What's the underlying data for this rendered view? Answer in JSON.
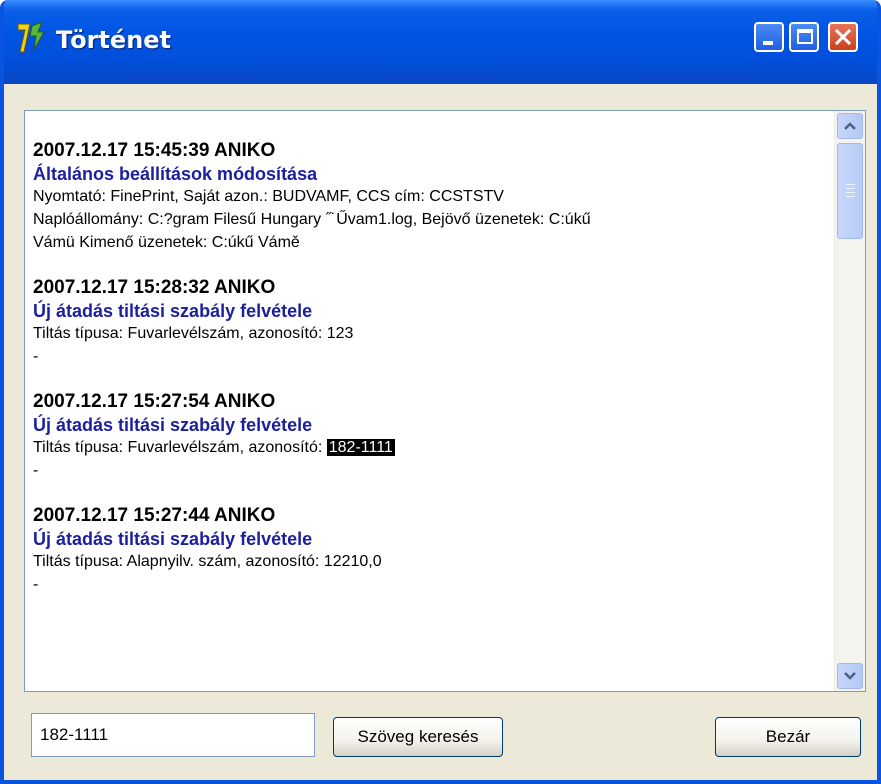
{
  "window": {
    "title": "Történet"
  },
  "entries": [
    {
      "header": "2007.12.17 15:45:39 ANIKO",
      "title": "Általános beállítások módosítása",
      "lines": [
        "Nyomtató: FinePrint, Saját azon.: BUDVAMF, CCS cím: CCSTSTV",
        "Naplóállomány: C:?gram Filesű Hungary ˝˙Űvam1.log, Bejövő üzenetek: C:úkű",
        "Vámü Kimenő üzenetek: C:úkű Vámě"
      ]
    },
    {
      "header": "2007.12.17 15:28:32 ANIKO",
      "title": "Új átadás tiltási szabály felvétele",
      "line_prefix": "Tiltás típusa: Fuvarlevélszám, azonosító: ",
      "line_value": "123",
      "trailer": "-"
    },
    {
      "header": "2007.12.17 15:27:54 ANIKO",
      "title": "Új átadás tiltási szabály felvétele",
      "line_prefix": "Tiltás típusa: Fuvarlevélszám, azonosító: ",
      "line_value": "182-1111",
      "trailer": "-"
    },
    {
      "header": "2007.12.17 15:27:44 ANIKO",
      "title": "Új átadás tiltási szabály felvétele",
      "line_prefix": "Tiltás típusa: Alapnyilv. szám, azonosító: ",
      "line_value": "12210,0",
      "trailer": "-"
    }
  ],
  "search": {
    "value": "182-1111",
    "button_label": "Szöveg keresés"
  },
  "close_button_label": "Bezár",
  "icons": {
    "app": "app-logo-icon",
    "minimize": "minimize-icon",
    "maximize": "maximize-icon",
    "close": "close-icon",
    "scroll_up": "chevron-up-icon",
    "scroll_down": "chevron-down-icon"
  },
  "colors": {
    "titlebar": "#0054e3",
    "entry_title": "#1b1fa0",
    "highlight_bg": "#000000",
    "window_bg": "#ece9d8"
  }
}
